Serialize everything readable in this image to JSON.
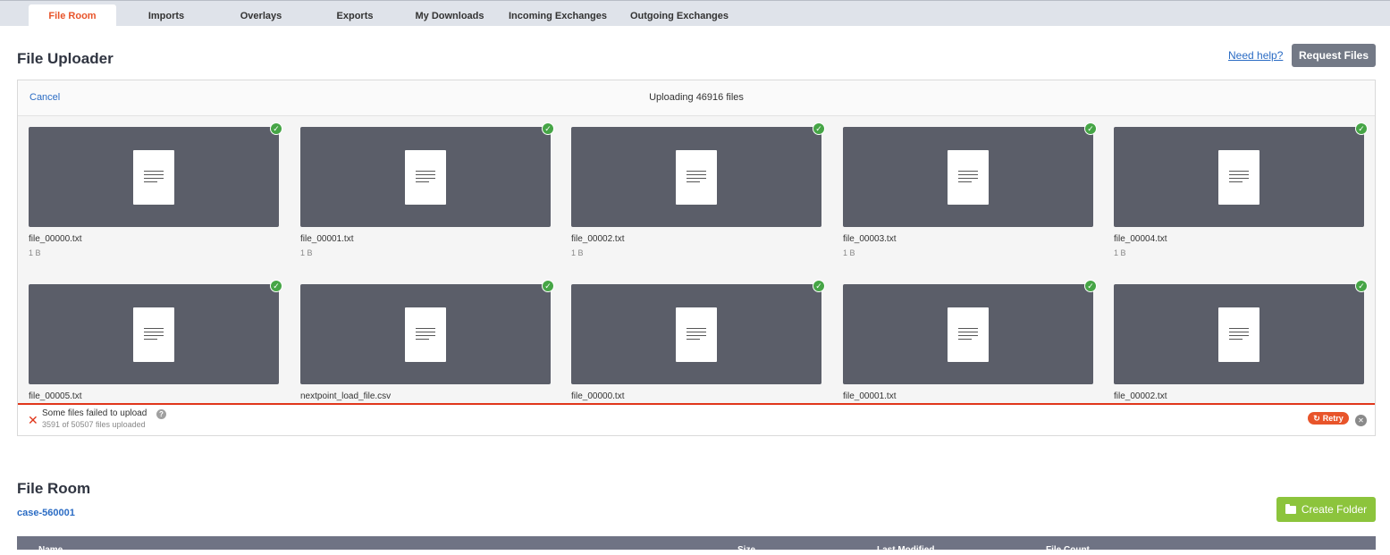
{
  "tabs": [
    {
      "label": "File Room",
      "active": true
    },
    {
      "label": "Imports"
    },
    {
      "label": "Overlays"
    },
    {
      "label": "Exports"
    },
    {
      "label": "My Downloads"
    },
    {
      "label": "Incoming Exchanges"
    },
    {
      "label": "Outgoing Exchanges"
    }
  ],
  "header": {
    "title": "File Uploader",
    "help_link": "Need help?",
    "request_button": "Request Files"
  },
  "uploader": {
    "cancel": "Cancel",
    "status": "Uploading 46916 files",
    "files": [
      {
        "name": "file_00000.txt",
        "size": "1 B"
      },
      {
        "name": "file_00001.txt",
        "size": "1 B"
      },
      {
        "name": "file_00002.txt",
        "size": "1 B"
      },
      {
        "name": "file_00003.txt",
        "size": "1 B"
      },
      {
        "name": "file_00004.txt",
        "size": "1 B"
      },
      {
        "name": "file_00005.txt",
        "size": ""
      },
      {
        "name": "nextpoint_load_file.csv",
        "size": ""
      },
      {
        "name": "file_00000.txt",
        "size": ""
      },
      {
        "name": "file_00001.txt",
        "size": ""
      },
      {
        "name": "file_00002.txt",
        "size": ""
      }
    ],
    "error_title": "Some files failed to upload",
    "error_sub": "3591 of 50507 files uploaded",
    "retry": "Retry",
    "colors": {
      "accent": "#e8542a",
      "error": "#e0361b",
      "success": "#46a546"
    }
  },
  "file_room": {
    "title": "File Room",
    "breadcrumb": "case-560001",
    "create_button": "Create Folder",
    "columns": [
      "Name",
      "Size",
      "Last Modified",
      "File Count"
    ]
  }
}
